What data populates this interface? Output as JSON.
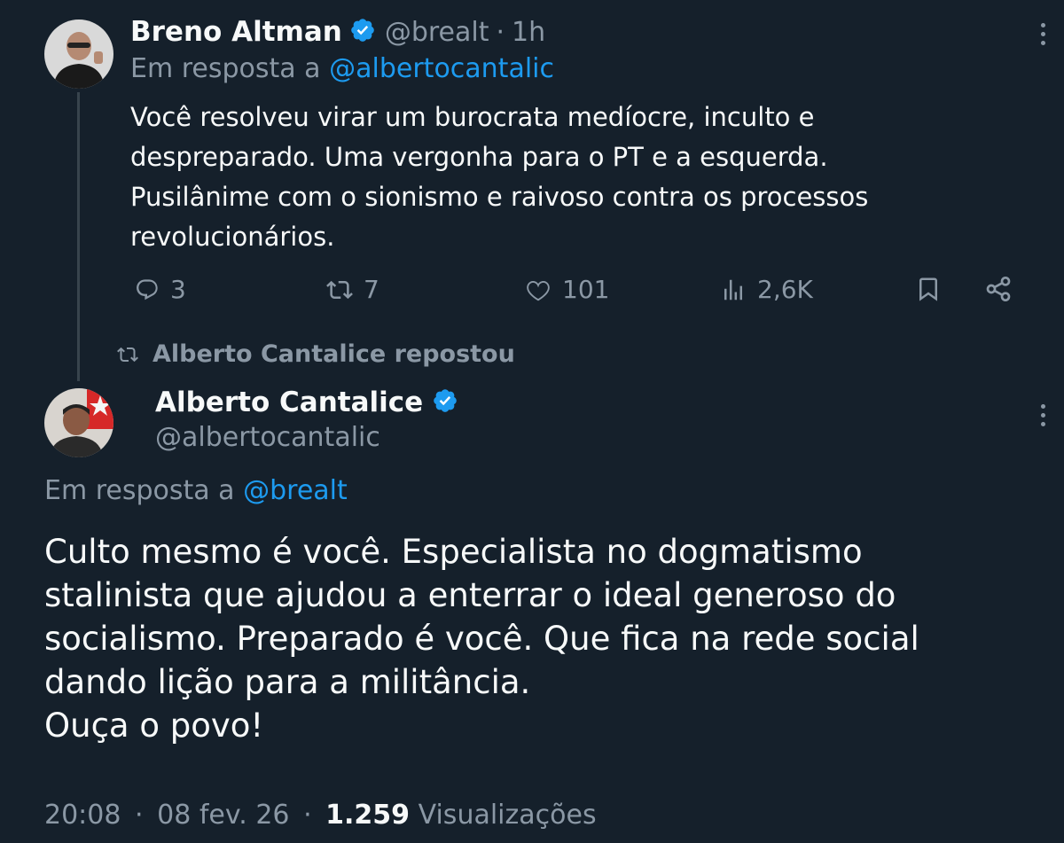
{
  "reply_tweet": {
    "author_name": "Breno Altman",
    "handle": "@brealt",
    "separator": "·",
    "time": "1h",
    "reply_prefix": "Em resposta a",
    "reply_to": "@albertocantalic",
    "text_lines": [
      "Você resolveu virar um burocrata medíocre, inculto e",
      "despreparado. Uma vergonha para o PT e a esquerda.",
      "Pusilânime com o sionismo e raivoso contra os processos",
      "revolucionários."
    ],
    "actions": {
      "replies": "3",
      "reposts": "7",
      "likes": "101",
      "views": "2,6K"
    }
  },
  "repost_notice": "Alberto Cantalice repostou",
  "main_tweet": {
    "author_name": "Alberto Cantalice",
    "handle": "@albertocantalic",
    "reply_prefix": "Em resposta a",
    "reply_to": "@brealt",
    "text_lines": [
      "Culto mesmo é você. Especialista no dogmatismo",
      "stalinista que ajudou a enterrar o ideal generoso do",
      "socialismo. Preparado é você. Que fica na rede social",
      "dando lição para a militância.",
      "Ouça o povo!"
    ],
    "time": "20:08",
    "date": "08 fev. 26",
    "view_count": "1.259",
    "view_label": "Visualizações"
  },
  "colors": {
    "background": "#15202b",
    "text": "#f7f9f9",
    "muted": "#8b98a5",
    "accent": "#1d9bf0",
    "thread_line": "#38444d"
  },
  "icons": [
    "verified-badge-icon",
    "reply-icon",
    "repost-icon",
    "like-icon",
    "views-icon",
    "bookmark-icon",
    "share-icon",
    "more-icon"
  ]
}
